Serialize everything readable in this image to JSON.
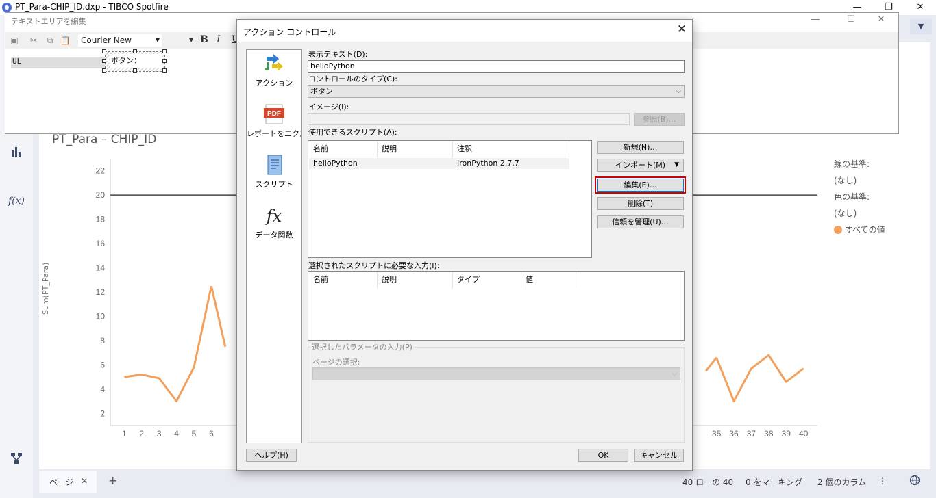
{
  "app": {
    "title": "PT_Para-CHIP_ID.dxp - TIBCO Spotfire",
    "minimize_glyph": "—",
    "restore_glyph": "❐",
    "close_glyph": "✕"
  },
  "text_editor": {
    "title": "テキストエリアを編集",
    "font_name": "Courier New",
    "bold": "B",
    "italic": "I",
    "underline": "U",
    "body_text": "UL",
    "button_text": "ボタン："
  },
  "chart": {
    "chart_data": {
      "type": "line",
      "title": "PT_Para – CHIP_ID",
      "ylabel": "Sum(PT_Para)",
      "xlabel": "",
      "ylim": [
        1,
        23
      ],
      "yticks": [
        2,
        4,
        6,
        8,
        10,
        12,
        14,
        16,
        18,
        20,
        22
      ],
      "x_left": [
        1,
        2,
        3,
        4,
        5,
        6
      ],
      "y_left": [
        5.0,
        5.2,
        4.9,
        3.0,
        5.8,
        12.5
      ],
      "x_right": [
        35,
        36,
        37,
        38,
        39,
        40
      ],
      "y_right": [
        6.6,
        3.0,
        5.7,
        6.8,
        4.6,
        5.7
      ],
      "x_visible_ticks_left": [
        1,
        2,
        3,
        4,
        5,
        6
      ],
      "x_visible_ticks_right": [
        35,
        36,
        37,
        38,
        39,
        40
      ],
      "reference_line_y": 20,
      "series_color": "#f2a05e",
      "legend": {
        "line_by_label": "線の基準:",
        "line_by_value": "(なし)",
        "color_by_label": "色の基準:",
        "color_by_value": "(なし)",
        "series_label": "すべての値"
      }
    }
  },
  "statusbar": {
    "page_tab": "ページ",
    "page_close": "✕",
    "add_page": "+",
    "rows": "40 ローの 40",
    "marking": "0 をマーキング",
    "columns": "2 個のカラム",
    "more": "⋮",
    "globe": "🌐"
  },
  "dialog": {
    "title": "アクション コントロール",
    "close_glyph": "✕",
    "side_items": [
      {
        "label": "アクション",
        "icon": "action-arrows-icon"
      },
      {
        "label": "レポートをエクスポート",
        "icon": "pdf-icon"
      },
      {
        "label": "スクリプト",
        "icon": "script-icon"
      },
      {
        "label": "データ関数",
        "icon": "function-icon"
      }
    ],
    "display_text_label": "表示テキスト(D):",
    "display_text_value": "helloPython",
    "control_type_label": "コントロールのタイプ(C):",
    "control_type_value": "ボタン",
    "image_label": "イメージ(I):",
    "browse_button": "参照(B)…",
    "available_scripts_label": "使用できるスクリプト(A):",
    "scripts_columns": [
      "名前",
      "説明",
      "注釈"
    ],
    "scripts_rows": [
      {
        "name": "helloPython",
        "description": "",
        "annotation": "IronPython 2.7.7"
      }
    ],
    "new_button": "新規(N)…",
    "import_button": "インポート(M)",
    "edit_button": "編集(E)…",
    "delete_button": "削除(T)",
    "trust_button": "信頼を管理(U)…",
    "required_inputs_label": "選択されたスクリプトに必要な入力(I):",
    "inputs_columns": [
      "名前",
      "説明",
      "タイプ",
      "値"
    ],
    "param_group_title": "選択したパラメータの入力(P)",
    "page_select_label": "ページの選択:",
    "help_button": "ヘルプ(H)",
    "ok_button": "OK",
    "cancel_button": "キャンセル"
  },
  "colors": {
    "highlight": "#d10000",
    "series": "#f2a05e",
    "app_bg": "#e9ebf2"
  }
}
